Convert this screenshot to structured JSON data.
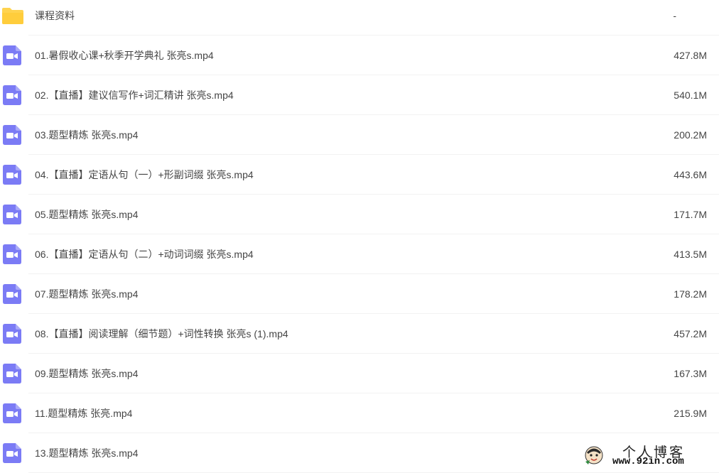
{
  "icons": {
    "folder": "folder-icon",
    "video": "video-file-icon"
  },
  "colors": {
    "folder": "#FFD34F",
    "video": "#7B7BF5"
  },
  "files": [
    {
      "name": "课程资料",
      "size": "-",
      "type": "folder"
    },
    {
      "name": "01.暑假收心课+秋季开学典礼 张亮s.mp4",
      "size": "427.8M",
      "type": "video"
    },
    {
      "name": "02.【直播】建议信写作+词汇精讲 张亮s.mp4",
      "size": "540.1M",
      "type": "video"
    },
    {
      "name": "03.题型精炼 张亮s.mp4",
      "size": "200.2M",
      "type": "video"
    },
    {
      "name": "04.【直播】定语从句（一）+形副词缀 张亮s.mp4",
      "size": "443.6M",
      "type": "video"
    },
    {
      "name": "05.题型精炼 张亮s.mp4",
      "size": "171.7M",
      "type": "video"
    },
    {
      "name": "06.【直播】定语从句（二）+动词词缀 张亮s.mp4",
      "size": "413.5M",
      "type": "video"
    },
    {
      "name": "07.题型精炼 张亮s.mp4",
      "size": "178.2M",
      "type": "video"
    },
    {
      "name": "08.【直播】阅读理解（细节题）+词性转换 张亮s (1).mp4",
      "size": "457.2M",
      "type": "video"
    },
    {
      "name": "09.题型精炼 张亮s.mp4",
      "size": "167.3M",
      "type": "video"
    },
    {
      "name": "11.题型精炼 张亮.mp4",
      "size": "215.9M",
      "type": "video"
    },
    {
      "name": "13.题型精炼 张亮s.mp4",
      "size": "",
      "type": "video"
    }
  ],
  "watermark": {
    "title": "个人博客",
    "url": "www.92in.com"
  }
}
